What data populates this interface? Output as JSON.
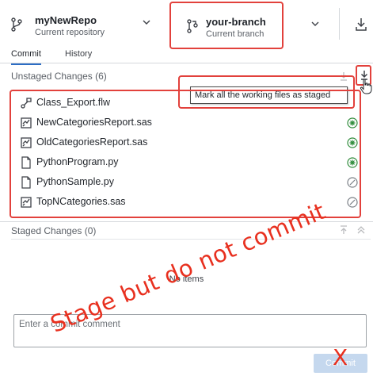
{
  "header": {
    "repo": {
      "title": "myNewRepo",
      "subtitle": "Current repository"
    },
    "branch": {
      "title": "your-branch",
      "subtitle": "Current branch"
    }
  },
  "tabs": [
    {
      "label": "Commit",
      "active": true
    },
    {
      "label": "History",
      "active": false
    }
  ],
  "unstaged": {
    "title": "Unstaged Changes (6)",
    "tooltip": "Mark all the working files as staged",
    "files": [
      {
        "name": "Class_Export.flw",
        "icon": "flow-file-icon",
        "status": "modified-icon"
      },
      {
        "name": "NewCategoriesReport.sas",
        "icon": "sas-file-icon",
        "status": "added-icon"
      },
      {
        "name": "OldCategoriesReport.sas",
        "icon": "sas-file-icon",
        "status": "added-icon"
      },
      {
        "name": "PythonProgram.py",
        "icon": "py-file-icon",
        "status": "added-icon"
      },
      {
        "name": "PythonSample.py",
        "icon": "py-file-icon",
        "status": "deleted-icon"
      },
      {
        "name": "TopNCategories.sas",
        "icon": "sas-file-icon",
        "status": "deleted-icon"
      }
    ]
  },
  "staged": {
    "title": "Staged Changes (0)",
    "empty_text": "No items"
  },
  "commit": {
    "placeholder": "Enter a commit comment",
    "button_label": "Commit"
  },
  "annotation": {
    "text": "Stage but do not commit",
    "x_mark": "X"
  },
  "colors": {
    "annotation_red": "#e2413c",
    "accent_blue": "#2c6dc4",
    "added_green": "#2e8b3a",
    "commit_disabled": "#c5d8ee"
  }
}
